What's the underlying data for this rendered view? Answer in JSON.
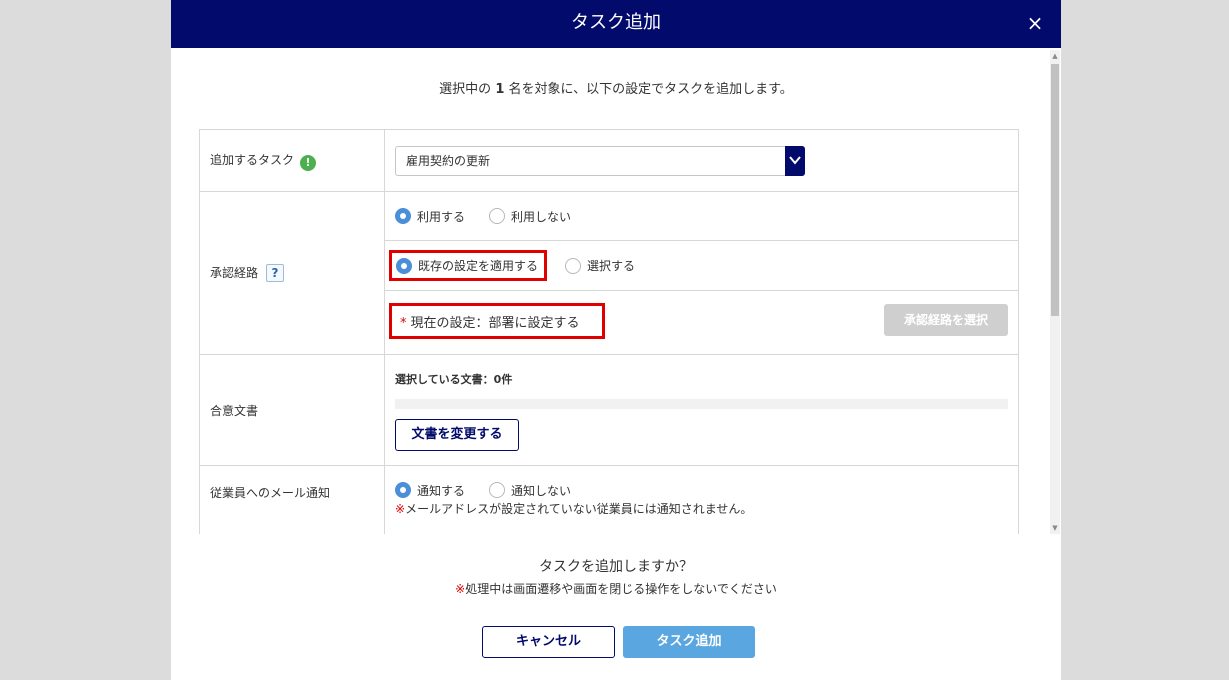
{
  "modal": {
    "title": "タスク追加",
    "close_label": "×"
  },
  "intro": {
    "before": "選択中の ",
    "count": "1",
    "after": " 名を対象に、以下の設定でタスクを追加します。"
  },
  "task_row": {
    "label": "追加するタスク",
    "alert_icon": "!",
    "selected": "雇用契約の更新"
  },
  "approval_row": {
    "label": "承認経路",
    "help_icon": "?",
    "use_options": [
      "利用する",
      "利用しない"
    ],
    "apply_options": [
      "既存の設定を適用する",
      "選択する"
    ],
    "current_star": "*",
    "current_setting": "現在の設定：部署に設定する",
    "select_button": "承認経路を選択"
  },
  "doc_row": {
    "label": "合意文書",
    "caption": "選択している文書：0件",
    "change_button": "文書を変更する"
  },
  "mail_row": {
    "label": "従業員へのメール通知",
    "options": [
      "通知する",
      "通知しない"
    ],
    "note_mark": "※",
    "note": "メールアドレスが設定されていない従業員には通知されません。"
  },
  "footer": {
    "question": "タスクを追加しますか？",
    "warn_mark": "※",
    "warn": "処理中は画面遷移や画面を閉じる操作をしないでください",
    "cancel": "キャンセル",
    "submit": "タスク追加"
  },
  "colors": {
    "header_bg": "#020a6b",
    "highlight_red": "#e10000",
    "primary_blue": "#5aa6e0",
    "radio_blue": "#4a8fd8"
  }
}
